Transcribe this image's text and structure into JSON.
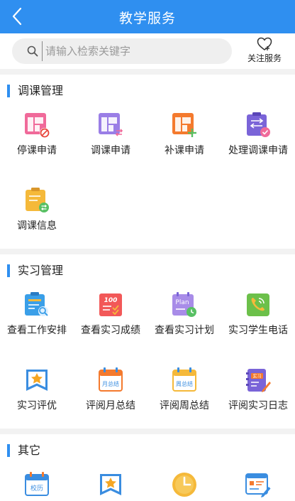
{
  "header": {
    "title": "教学服务"
  },
  "search": {
    "placeholder": "请输入检索关键字"
  },
  "follow": {
    "label": "关注服务"
  },
  "sections": [
    {
      "title": "调课管理",
      "items": [
        {
          "label": "停课申请",
          "icon": "stop-class-icon"
        },
        {
          "label": "调课申请",
          "icon": "swap-class-icon"
        },
        {
          "label": "补课申请",
          "icon": "makeup-class-icon"
        },
        {
          "label": "处理调课申请",
          "icon": "handle-adjust-icon"
        },
        {
          "label": "调课信息",
          "icon": "adjust-info-icon"
        }
      ]
    },
    {
      "title": "实习管理",
      "items": [
        {
          "label": "查看工作安排",
          "icon": "work-arrangement-icon"
        },
        {
          "label": "查看实习成绩",
          "icon": "internship-score-icon"
        },
        {
          "label": "查看实习计划",
          "icon": "internship-plan-icon"
        },
        {
          "label": "实习学生电话",
          "icon": "student-phone-icon"
        },
        {
          "label": "实习评优",
          "icon": "award-icon"
        },
        {
          "label": "评阅月总结",
          "icon": "monthly-summary-icon"
        },
        {
          "label": "评阅周总结",
          "icon": "weekly-summary-icon"
        },
        {
          "label": "评阅实习日志",
          "icon": "internship-log-icon"
        }
      ]
    },
    {
      "title": "其它",
      "items": [
        {
          "label": "",
          "icon": "school-calendar-icon"
        },
        {
          "label": "",
          "icon": "award-icon"
        },
        {
          "label": "",
          "icon": "clock-icon"
        },
        {
          "label": "",
          "icon": "edit-document-icon"
        }
      ]
    }
  ],
  "icon_text": {
    "score": "100",
    "plan": "Plan",
    "month": "月总结",
    "week": "周总结",
    "log": "实习",
    "calendar": "校历"
  },
  "colors": {
    "brand": "#2f8ff0",
    "pink": "#f06a9a",
    "purple": "#9a7ee6",
    "orange": "#f47a2e",
    "yellow": "#f5b93a",
    "green": "#58c064",
    "blue": "#3a8de0"
  }
}
